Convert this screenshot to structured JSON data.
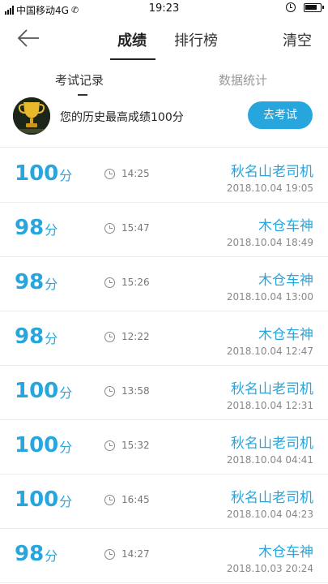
{
  "status_bar": {
    "carrier": "中国移动4G",
    "time": "19:23"
  },
  "header": {
    "tabs": [
      {
        "label": "成绩",
        "active": true
      },
      {
        "label": "排行榜",
        "active": false
      }
    ],
    "clear_label": "清空"
  },
  "subtabs": [
    {
      "label": "考试记录",
      "active": true
    },
    {
      "label": "数据统计",
      "active": false
    }
  ],
  "best": {
    "text": "您的历史最高成绩100分",
    "button_label": "去考试",
    "icon": "trophy-icon"
  },
  "records": [
    {
      "score": "100",
      "unit": "分",
      "duration": "14:25",
      "name": "秋名山老司机",
      "datetime": "2018.10.04 19:05"
    },
    {
      "score": "98",
      "unit": "分",
      "duration": "15:47",
      "name": "木仓车神",
      "datetime": "2018.10.04 18:49"
    },
    {
      "score": "98",
      "unit": "分",
      "duration": "15:26",
      "name": "木仓车神",
      "datetime": "2018.10.04 13:00"
    },
    {
      "score": "98",
      "unit": "分",
      "duration": "12:22",
      "name": "木仓车神",
      "datetime": "2018.10.04 12:47"
    },
    {
      "score": "100",
      "unit": "分",
      "duration": "13:58",
      "name": "秋名山老司机",
      "datetime": "2018.10.04 12:31"
    },
    {
      "score": "100",
      "unit": "分",
      "duration": "15:32",
      "name": "秋名山老司机",
      "datetime": "2018.10.04 04:41"
    },
    {
      "score": "100",
      "unit": "分",
      "duration": "16:45",
      "name": "秋名山老司机",
      "datetime": "2018.10.04 04:23"
    },
    {
      "score": "98",
      "unit": "分",
      "duration": "14:27",
      "name": "木仓车神",
      "datetime": "2018.10.03 20:24"
    }
  ],
  "colors": {
    "accent": "#27a6de",
    "text": "#333333",
    "muted": "#888888"
  }
}
